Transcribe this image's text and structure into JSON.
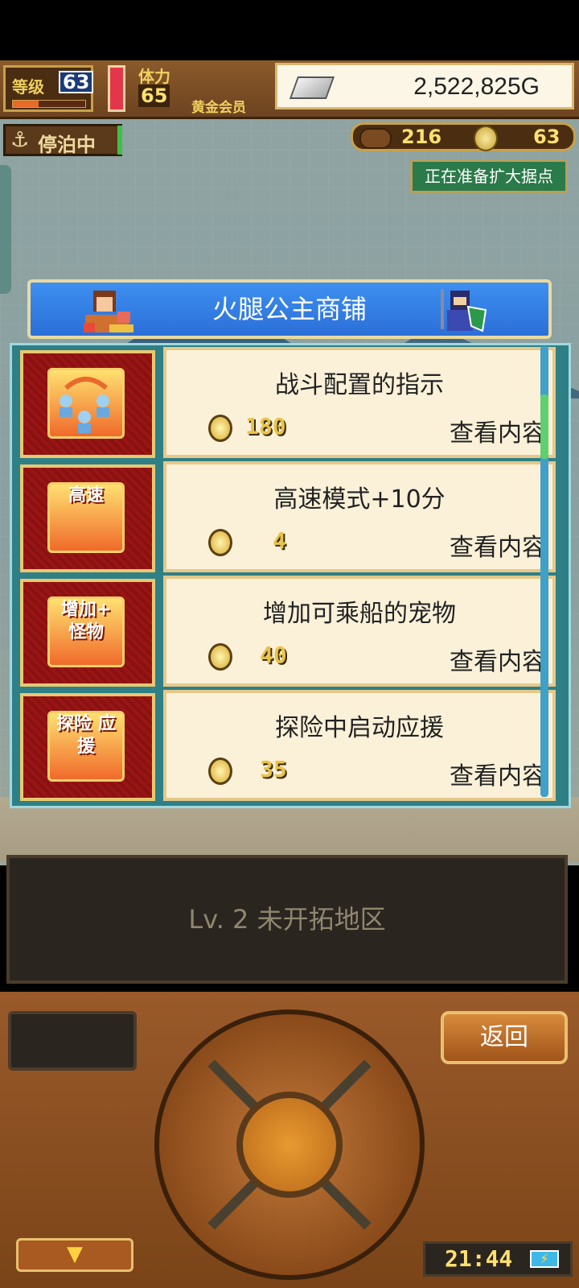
{
  "status_bar": {
    "level_label": "等级",
    "level_value": "63",
    "level_progress": 0.35,
    "stamina_label": "体力",
    "stamina_value": "65",
    "member_label": "黄金会员",
    "gold_value": "2,522,825G"
  },
  "second_row": {
    "docked_label": "停泊中",
    "meat_value": "216",
    "coin_value": "63",
    "expand_badge": "正在准备扩大据点"
  },
  "shop": {
    "title": "火腿公主商铺",
    "items": [
      {
        "title": "战斗配置的指示",
        "price": "180",
        "action": "查看内容",
        "icon_text": ""
      },
      {
        "title": "高速模式+10分",
        "price": "4",
        "action": "查看内容",
        "icon_text": "高速"
      },
      {
        "title": "增加可乘船的宠物",
        "price": "40",
        "action": "查看内容",
        "icon_text": "增加+ 怪物"
      },
      {
        "title": "探险中启动应援",
        "price": "35",
        "action": "查看内容",
        "icon_text": "探险 应援"
      }
    ]
  },
  "info_panel": {
    "text": "Lv. 2 未开拓地区"
  },
  "controls": {
    "back_label": "返回",
    "menu_toggle_symbol": "▼",
    "clock": "21:44",
    "battery_symbol": "⚡"
  },
  "colors": {
    "shop_header": "#2b6fd8",
    "card_bg": "#fbf1d9",
    "thumb_bg": "#9b1414",
    "coin": "#d9a830"
  }
}
